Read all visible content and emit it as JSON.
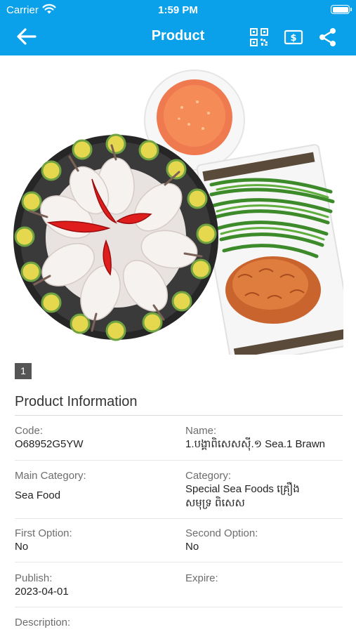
{
  "status_bar": {
    "carrier": "Carrier",
    "time": "1:59 PM"
  },
  "nav": {
    "title": "Product",
    "icons": [
      "back-arrow-icon",
      "qr-code-icon",
      "price-tag-icon",
      "share-icon"
    ]
  },
  "gallery": {
    "page_indicator": "1"
  },
  "product_info": {
    "title": "Product Information",
    "code_label": "Code:",
    "code_value": "O68952G5YW",
    "name_label": "Name:",
    "name_value": "1.បង្គាពិសេសស៊ី.១ Sea.1 Brawn",
    "main_category_label": "Main Category:",
    "main_category_value": "Sea Food",
    "category_label": "Category:",
    "category_value_line1": "Special Sea Foods គ្រឿង",
    "category_value_line2": "សមុទ្រ ពិសេស",
    "first_option_label": "First Option:",
    "first_option_value": "No",
    "second_option_label": "Second Option:",
    "second_option_value": "No",
    "publish_label": "Publish:",
    "publish_value": "2023-04-01",
    "expire_label": "Expire:",
    "description_label": "Description:"
  },
  "colors": {
    "header": "#0aa1ea",
    "page_indicator": "#555555"
  }
}
